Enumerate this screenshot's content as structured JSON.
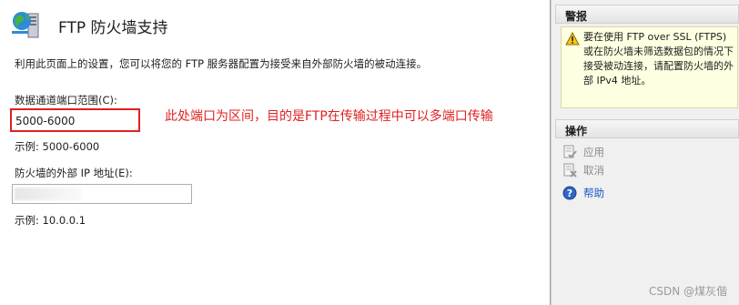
{
  "page": {
    "title": "FTP 防火墙支持",
    "description": "利用此页面上的设置，您可以将您的 FTP 服务器配置为接受来自外部防火墙的被动连接。",
    "data_channel_range_label": "数据通道端口范围(C):",
    "data_channel_range_value": "5000-6000",
    "data_channel_range_example": "示例: 5000-6000",
    "external_ip_label": "防火墙的外部 IP 地址(E):",
    "external_ip_value": "",
    "external_ip_example": "示例: 10.0.0.1",
    "annotation": "此处端口为区间，目的是FTP在传输过程中可以多端口传输"
  },
  "sidebar": {
    "alert_header": "警报",
    "alert_text": "要在使用 FTP over SSL (FTPS)或在防火墙未筛选数据包的情况下接受被动连接，请配置防火墙的外部 IPv4 地址。",
    "actions_header": "操作",
    "actions": [
      {
        "label": "应用",
        "icon": "apply-icon",
        "enabled": false
      },
      {
        "label": "取消",
        "icon": "cancel-icon",
        "enabled": false
      },
      {
        "label": "帮助",
        "icon": "help-icon",
        "enabled": true
      }
    ]
  },
  "watermark": "CSDN @煤灰偕",
  "colors": {
    "annotation": "#e02020",
    "help_link": "#1a56c8",
    "alert_bg": "#ffffe1"
  }
}
